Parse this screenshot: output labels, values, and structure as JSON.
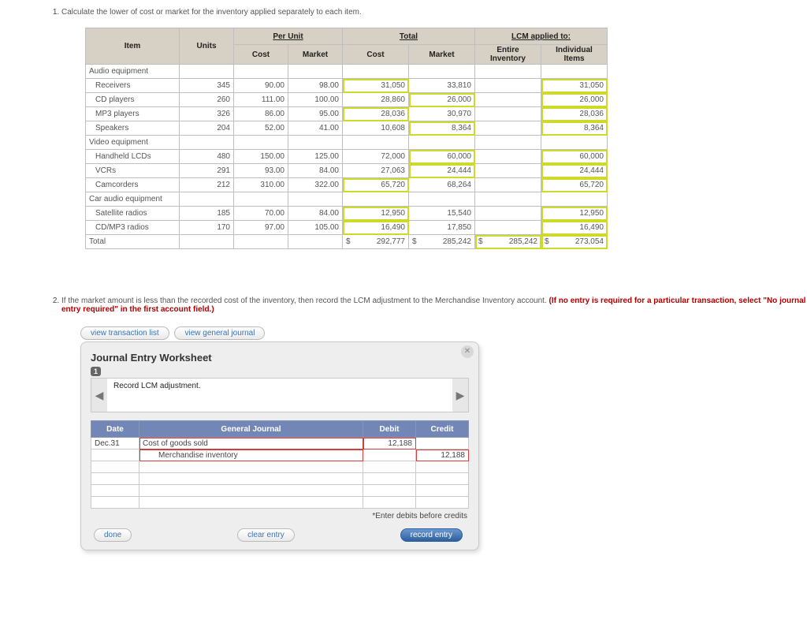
{
  "q1": {
    "prompt": "Calculate the lower of cost or market for the inventory applied separately to each item.",
    "headers": {
      "item": "Item",
      "units": "Units",
      "per_unit": "Per Unit",
      "cost": "Cost",
      "market": "Market",
      "total": "Total",
      "tcost": "Cost",
      "tmarket": "Market",
      "lcm": "LCM applied to:",
      "entire": "Entire Inventory",
      "indiv": "Individual Items"
    },
    "sections": {
      "s1": "Audio equipment",
      "s2": "Video equipment",
      "s3": "Car audio equipment"
    },
    "rows": {
      "r1": {
        "item": "Receivers",
        "units": "345",
        "cost": "90.00",
        "market": "98.00",
        "tcost": "31,050",
        "tmarket": "33,810",
        "indiv": "31,050"
      },
      "r2": {
        "item": "CD players",
        "units": "260",
        "cost": "111.00",
        "market": "100.00",
        "tcost": "28,860",
        "tmarket": "26,000",
        "indiv": "26,000"
      },
      "r3": {
        "item": "MP3 players",
        "units": "326",
        "cost": "86.00",
        "market": "95.00",
        "tcost": "28,036",
        "tmarket": "30,970",
        "indiv": "28,036"
      },
      "r4": {
        "item": "Speakers",
        "units": "204",
        "cost": "52.00",
        "market": "41.00",
        "tcost": "10,608",
        "tmarket": "8,364",
        "indiv": "8,364"
      },
      "r5": {
        "item": "Handheld LCDs",
        "units": "480",
        "cost": "150.00",
        "market": "125.00",
        "tcost": "72,000",
        "tmarket": "60,000",
        "indiv": "60,000"
      },
      "r6": {
        "item": "VCRs",
        "units": "291",
        "cost": "93.00",
        "market": "84.00",
        "tcost": "27,063",
        "tmarket": "24,444",
        "indiv": "24,444"
      },
      "r7": {
        "item": "Camcorders",
        "units": "212",
        "cost": "310.00",
        "market": "322.00",
        "tcost": "65,720",
        "tmarket": "68,264",
        "indiv": "65,720"
      },
      "r8": {
        "item": "Satellite radios",
        "units": "185",
        "cost": "70.00",
        "market": "84.00",
        "tcost": "12,950",
        "tmarket": "15,540",
        "indiv": "12,950"
      },
      "r9": {
        "item": "CD/MP3 radios",
        "units": "170",
        "cost": "97.00",
        "market": "105.00",
        "tcost": "16,490",
        "tmarket": "17,850",
        "indiv": "16,490"
      }
    },
    "total": {
      "label": "Total",
      "tcost": "292,777",
      "tmarket": "285,242",
      "entire": "285,242",
      "indiv": "273,054"
    }
  },
  "q2": {
    "prompt_a": "If the market amount is less than the recorded cost of the inventory, then record the LCM adjustment to the Merchandise Inventory account. ",
    "prompt_b": "(If no entry is required for a particular transaction, select \"No journal entry required\" in the first account field.)",
    "btn_list": "view transaction list",
    "btn_gj": "view general journal",
    "panel_title": "Journal Entry Worksheet",
    "step": "1",
    "record_text": "Record LCM adjustment.",
    "gj_headers": {
      "date": "Date",
      "gj": "General Journal",
      "debit": "Debit",
      "credit": "Credit"
    },
    "entries": {
      "e1": {
        "date": "Dec.31",
        "acct": "Cost of goods sold",
        "debit": "12,188",
        "credit": ""
      },
      "e2": {
        "date": "",
        "acct": "Merchandise inventory",
        "debit": "",
        "credit": "12,188"
      }
    },
    "footnote": "*Enter debits before credits",
    "btn_done": "done",
    "btn_clear": "clear entry",
    "btn_record": "record entry",
    "close": "✕"
  },
  "sym": {
    "dollar": "$",
    "arrow_l": "◀",
    "arrow_r": "▶"
  }
}
